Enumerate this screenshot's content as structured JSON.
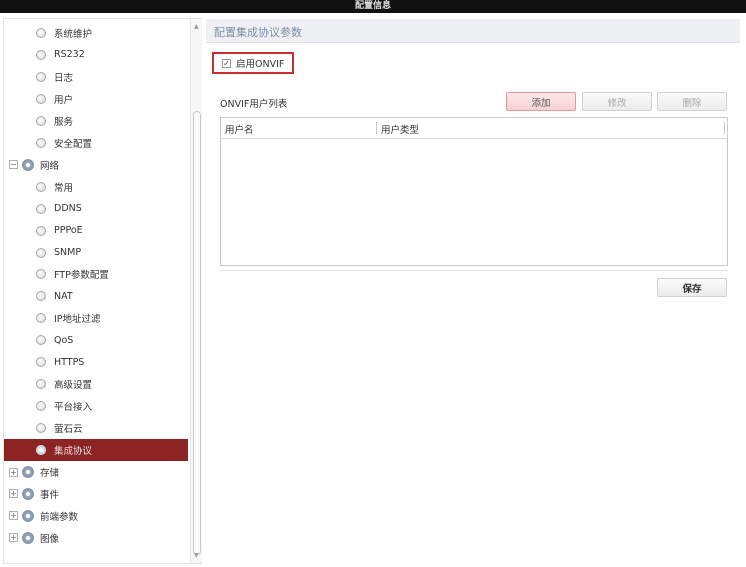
{
  "window": {
    "title": "配置信息"
  },
  "sidebar": {
    "items": [
      {
        "label": "系统维护",
        "kind": "child"
      },
      {
        "label": "RS232",
        "kind": "child"
      },
      {
        "label": "日志",
        "kind": "child"
      },
      {
        "label": "用户",
        "kind": "child"
      },
      {
        "label": "服务",
        "kind": "child"
      },
      {
        "label": "安全配置",
        "kind": "child"
      },
      {
        "label": "网络",
        "kind": "group",
        "toggle": "−"
      },
      {
        "label": "常用",
        "kind": "child"
      },
      {
        "label": "DDNS",
        "kind": "child"
      },
      {
        "label": "PPPoE",
        "kind": "child"
      },
      {
        "label": "SNMP",
        "kind": "child"
      },
      {
        "label": "FTP参数配置",
        "kind": "child"
      },
      {
        "label": "NAT",
        "kind": "child"
      },
      {
        "label": "IP地址过滤",
        "kind": "child"
      },
      {
        "label": "QoS",
        "kind": "child"
      },
      {
        "label": "HTTPS",
        "kind": "child"
      },
      {
        "label": "高级设置",
        "kind": "child"
      },
      {
        "label": "平台接入",
        "kind": "child"
      },
      {
        "label": "萤石云",
        "kind": "child"
      },
      {
        "label": "集成协议",
        "kind": "child",
        "active": true
      },
      {
        "label": "存储",
        "kind": "group",
        "toggle": "+"
      },
      {
        "label": "事件",
        "kind": "group",
        "toggle": "+"
      },
      {
        "label": "前端参数",
        "kind": "group",
        "toggle": "+"
      },
      {
        "label": "图像",
        "kind": "group",
        "toggle": "+"
      }
    ]
  },
  "main": {
    "section_title": "配置集成协议参数",
    "enable_onvif": {
      "label": "启用ONVIF",
      "checked": true
    },
    "user_list_label": "ONVIF用户列表",
    "buttons": {
      "add": "添加",
      "edit": "修改",
      "delete": "删除",
      "save": "保存"
    },
    "table": {
      "columns": [
        "用户名",
        "用户类型"
      ],
      "rows": []
    }
  },
  "colors": {
    "active_item_bg": "#8c2424",
    "highlight_border": "#c9302c",
    "add_button_bg": "#f6d2d2",
    "header_text": "#7a8fa8"
  }
}
